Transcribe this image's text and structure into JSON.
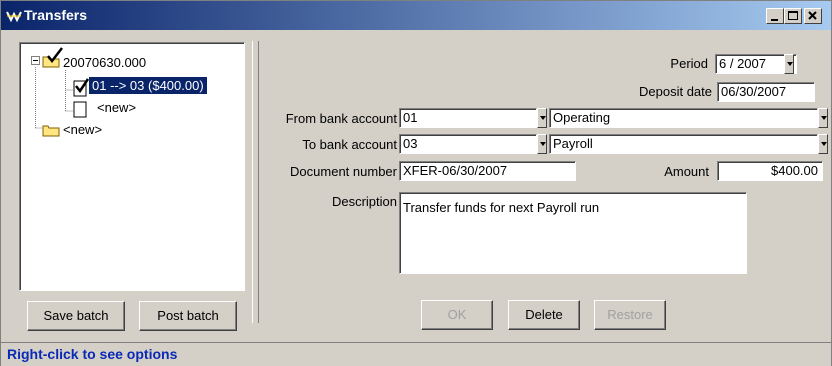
{
  "window": {
    "title": "Transfers"
  },
  "tree": {
    "root_label": "20070630.000",
    "selected_label": "01 --> 03 ($400.00)",
    "child_new_label": "<new>",
    "root_new_label": "<new>"
  },
  "buttons": {
    "save_batch": "Save batch",
    "post_batch": "Post batch",
    "ok": "OK",
    "delete": "Delete",
    "restore": "Restore"
  },
  "form": {
    "period_label": "Period",
    "period_value": "6 / 2007",
    "deposit_date_label": "Deposit date",
    "deposit_date_value": "06/30/2007",
    "from_bank_label": "From bank account",
    "from_bank_code": "01",
    "from_bank_name": "Operating",
    "to_bank_label": "To bank account",
    "to_bank_code": "03",
    "to_bank_name": "Payroll",
    "document_number_label": "Document number",
    "document_number_value": "XFER-06/30/2007",
    "amount_label": "Amount",
    "amount_value": "$400.00",
    "description_label": "Description",
    "description_value": "Transfer funds for next Payroll run"
  },
  "status": {
    "text": "Right-click to see options"
  },
  "colors": {
    "title_start": "#0a246a",
    "title_end": "#a6caf0",
    "selection": "#0a246a",
    "status_text": "#0a2ab6",
    "face": "#d4d0c8"
  },
  "icons": [
    "app-icon",
    "minimize-icon",
    "maximize-icon",
    "close-icon",
    "collapse-icon",
    "checkmark-icon",
    "folder-icon",
    "document-icon",
    "dropdown-arrow-icon"
  ]
}
